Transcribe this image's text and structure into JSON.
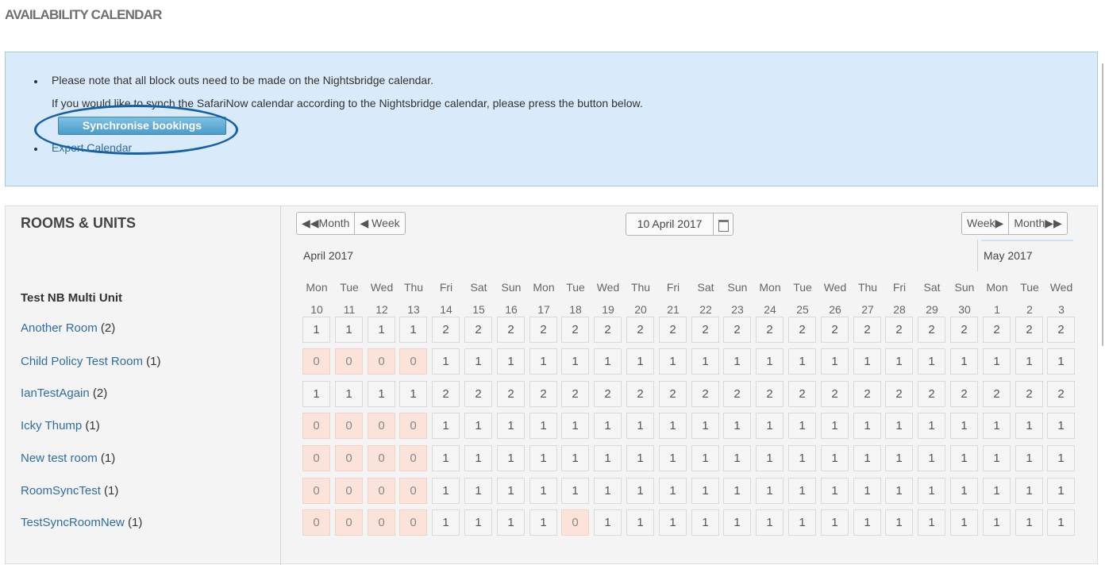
{
  "page_title": "AVAILABILITY CALENDAR",
  "notice": {
    "line1": "Please note that all block outs need to be made on the Nightsbridge calendar.",
    "line2": "If you would like to synch the SafariNow calendar according to the Nightsbridge calendar, please press the button below.",
    "sync_button": "Synchronise bookings",
    "export_link": "Export Calendar"
  },
  "rooms": {
    "title": "ROOMS & UNITS",
    "group": "Test NB Multi Unit",
    "items": [
      {
        "name": "Another Room",
        "count": "(2)"
      },
      {
        "name": "Child Policy Test Room",
        "count": "(1)"
      },
      {
        "name": "IanTestAgain",
        "count": "(2)"
      },
      {
        "name": "Icky Thump",
        "count": "(1)"
      },
      {
        "name": "New test room",
        "count": "(1)"
      },
      {
        "name": "RoomSyncTest",
        "count": "(1)"
      },
      {
        "name": "TestSyncRoomNew",
        "count": "(1)"
      }
    ]
  },
  "nav": {
    "prev_month": "Month",
    "prev_week": "Week",
    "date": "10 April 2017",
    "next_week": "Week",
    "next_month": "Month"
  },
  "months": [
    {
      "label": "April 2017"
    },
    {
      "label": "May 2017"
    }
  ],
  "days": [
    {
      "name": "Mon",
      "num": "10"
    },
    {
      "name": "Tue",
      "num": "11"
    },
    {
      "name": "Wed",
      "num": "12"
    },
    {
      "name": "Thu",
      "num": "13"
    },
    {
      "name": "Fri",
      "num": "14"
    },
    {
      "name": "Sat",
      "num": "15"
    },
    {
      "name": "Sun",
      "num": "16"
    },
    {
      "name": "Mon",
      "num": "17"
    },
    {
      "name": "Tue",
      "num": "18"
    },
    {
      "name": "Wed",
      "num": "19"
    },
    {
      "name": "Thu",
      "num": "20"
    },
    {
      "name": "Fri",
      "num": "21"
    },
    {
      "name": "Sat",
      "num": "22"
    },
    {
      "name": "Sun",
      "num": "23"
    },
    {
      "name": "Mon",
      "num": "24"
    },
    {
      "name": "Tue",
      "num": "25"
    },
    {
      "name": "Wed",
      "num": "26"
    },
    {
      "name": "Thu",
      "num": "27"
    },
    {
      "name": "Fri",
      "num": "28"
    },
    {
      "name": "Sat",
      "num": "29"
    },
    {
      "name": "Sun",
      "num": "30"
    },
    {
      "name": "Mon",
      "num": "1"
    },
    {
      "name": "Tue",
      "num": "2"
    },
    {
      "name": "Wed",
      "num": "3"
    }
  ],
  "availability": [
    [
      1,
      1,
      1,
      1,
      2,
      2,
      2,
      2,
      2,
      2,
      2,
      2,
      2,
      2,
      2,
      2,
      2,
      2,
      2,
      2,
      2,
      2,
      2,
      2
    ],
    [
      0,
      0,
      0,
      0,
      1,
      1,
      1,
      1,
      1,
      1,
      1,
      1,
      1,
      1,
      1,
      1,
      1,
      1,
      1,
      1,
      1,
      1,
      1,
      1
    ],
    [
      1,
      1,
      1,
      1,
      2,
      2,
      2,
      2,
      2,
      2,
      2,
      2,
      2,
      2,
      2,
      2,
      2,
      2,
      2,
      2,
      2,
      2,
      2,
      2
    ],
    [
      0,
      0,
      0,
      0,
      1,
      1,
      1,
      1,
      1,
      1,
      1,
      1,
      1,
      1,
      1,
      1,
      1,
      1,
      1,
      1,
      1,
      1,
      1,
      1
    ],
    [
      0,
      0,
      0,
      0,
      1,
      1,
      1,
      1,
      1,
      1,
      1,
      1,
      1,
      1,
      1,
      1,
      1,
      1,
      1,
      1,
      1,
      1,
      1,
      1
    ],
    [
      0,
      0,
      0,
      0,
      1,
      1,
      1,
      1,
      1,
      1,
      1,
      1,
      1,
      1,
      1,
      1,
      1,
      1,
      1,
      1,
      1,
      1,
      1,
      1
    ],
    [
      0,
      0,
      0,
      0,
      1,
      1,
      1,
      1,
      0,
      1,
      1,
      1,
      1,
      1,
      1,
      1,
      1,
      1,
      1,
      1,
      1,
      1,
      1,
      1
    ]
  ],
  "colors": {
    "notice_bg": "#d9eafa",
    "sync_button": "#4b9cca",
    "link": "#2e6da4",
    "blocked_cell": "#fbe3da",
    "highlight_ring": "#1561a8"
  }
}
